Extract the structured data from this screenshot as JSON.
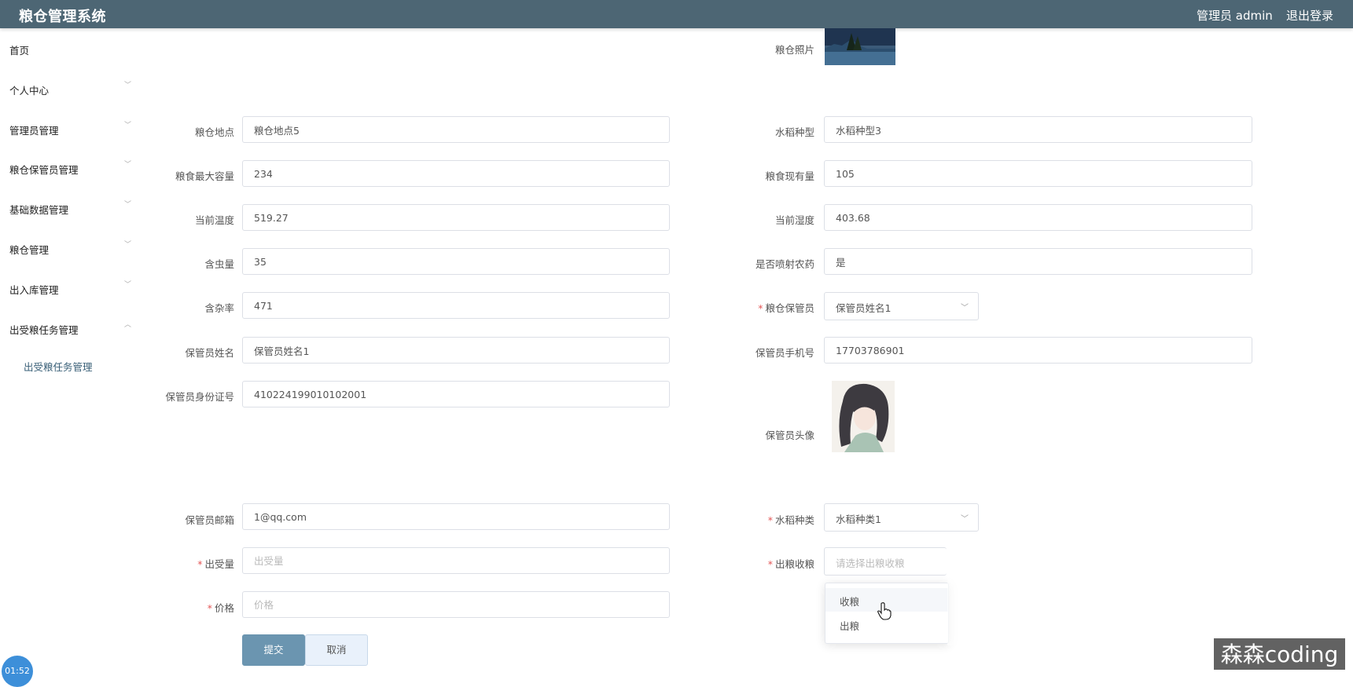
{
  "header": {
    "title": "粮仓管理系统",
    "user": "管理员 admin",
    "logout": "退出登录"
  },
  "sidebar": {
    "items": [
      {
        "label": "首页"
      },
      {
        "label": "个人中心"
      },
      {
        "label": "管理员管理"
      },
      {
        "label": "粮仓保管员管理"
      },
      {
        "label": "基础数据管理"
      },
      {
        "label": "粮仓管理"
      },
      {
        "label": "出入库管理"
      },
      {
        "label": "出受粮任务管理"
      }
    ],
    "sub_item": "出受粮任务管理"
  },
  "form": {
    "photo_label": "粮仓照片",
    "location_label": "粮仓地点",
    "location_value": "粮仓地点5",
    "rice_type_label": "水稻种型",
    "rice_type_value": "水稻种型3",
    "max_cap_label": "粮食最大容量",
    "max_cap_value": "234",
    "current_amount_label": "粮食现有量",
    "current_amount_value": "105",
    "temp_label": "当前温度",
    "temp_value": "519.27",
    "humidity_label": "当前湿度",
    "humidity_value": "403.68",
    "insect_label": "含虫量",
    "insect_value": "35",
    "pesticide_label": "是否喷射农药",
    "pesticide_value": "是",
    "impurity_label": "含杂率",
    "impurity_value": "471",
    "keeper_label": "粮仓保管员",
    "keeper_value": "保管员姓名1",
    "keeper_name_label": "保管员姓名",
    "keeper_name_value": "保管员姓名1",
    "keeper_phone_label": "保管员手机号",
    "keeper_phone_value": "17703786901",
    "keeper_id_label": "保管员身份证号",
    "keeper_id_value": "410224199010102001",
    "keeper_avatar_label": "保管员头像",
    "keeper_email_label": "保管员邮箱",
    "keeper_email_value": "1@qq.com",
    "rice_kind_label": "水稻种类",
    "rice_kind_value": "水稻种类1",
    "quantity_label": "出受量",
    "quantity_placeholder": "出受量",
    "inout_label": "出粮收粮",
    "inout_placeholder": "请选择出粮收粮",
    "price_label": "价格",
    "price_placeholder": "价格",
    "dropdown_options": [
      "收粮",
      "出粮"
    ],
    "submit_label": "提交",
    "cancel_label": "取消"
  },
  "overlay": {
    "timer": "01:52",
    "watermark": "森森coding"
  }
}
